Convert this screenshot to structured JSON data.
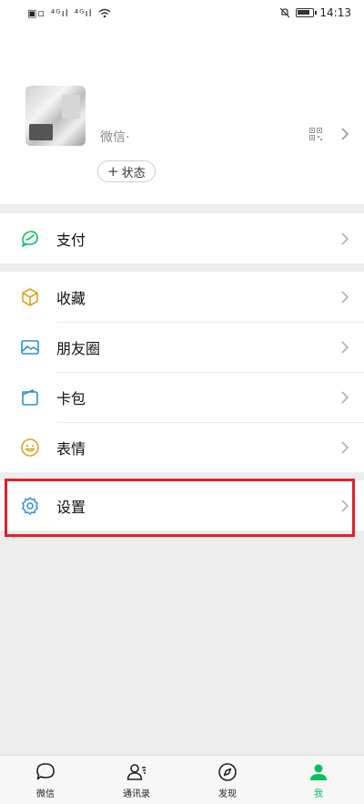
{
  "status_bar": {
    "time": "14:13"
  },
  "profile": {
    "nickname": "",
    "wechat_id_label": "微信·",
    "status_button": "状态"
  },
  "menu": {
    "pay": "支付",
    "favorites": "收藏",
    "moments": "朋友圈",
    "cards": "卡包",
    "stickers": "表情",
    "settings": "设置"
  },
  "tabs": [
    {
      "label": "微信",
      "active": false
    },
    {
      "label": "通讯录",
      "active": false
    },
    {
      "label": "发现",
      "active": false
    },
    {
      "label": "我",
      "active": true
    }
  ],
  "colors": {
    "accent": "#07c160",
    "highlight": "#e0222a"
  }
}
